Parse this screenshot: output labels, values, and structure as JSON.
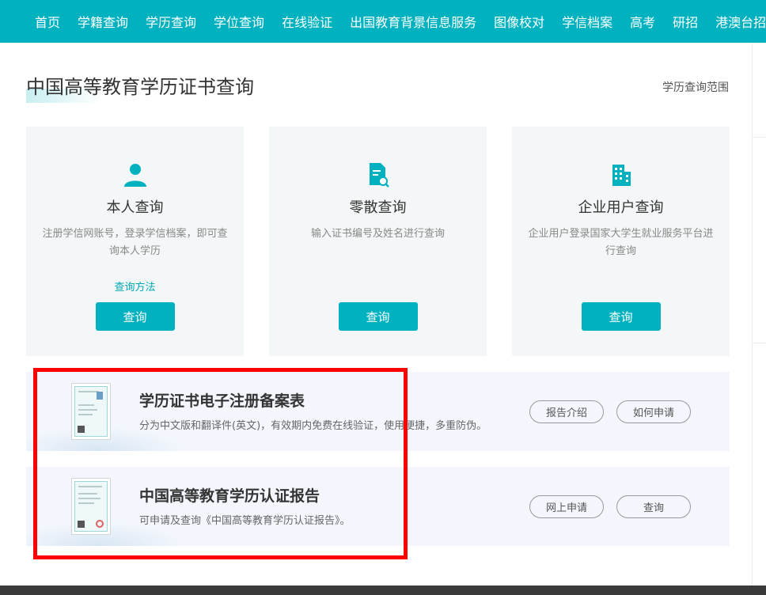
{
  "nav": {
    "items": [
      "首页",
      "学籍查询",
      "学历查询",
      "学位查询",
      "在线验证",
      "出国教育背景信息服务",
      "图像校对",
      "学信档案",
      "高考",
      "研招",
      "港澳台招"
    ]
  },
  "header": {
    "title": "中国高等教育学历证书查询",
    "scope_link": "学历查询范围"
  },
  "cards": [
    {
      "title": "本人查询",
      "desc": "注册学信网账号，登录学信档案，即可查询本人学历",
      "link": "查询方法",
      "button": "查询",
      "icon": "person-icon"
    },
    {
      "title": "零散查询",
      "desc": "输入证书编号及姓名进行查询",
      "button": "查询",
      "icon": "document-search-icon"
    },
    {
      "title": "企业用户查询",
      "desc": "企业用户登录国家大学生就业服务平台进行查询",
      "button": "查询",
      "icon": "building-icon"
    }
  ],
  "banners": [
    {
      "title": "学历证书电子注册备案表",
      "desc": "分为中文版和翻译件(英文)，有效期内免费在线验证，使用便捷，多重防伪。",
      "btn1": "报告介绍",
      "btn2": "如何申请"
    },
    {
      "title": "中国高等教育学历认证报告",
      "desc": "可申请及查询《中国高等教育学历认证报告》。",
      "btn1": "网上申请",
      "btn2": "查询"
    }
  ],
  "colors": {
    "accent": "#00b2c0",
    "highlight": "#ff0000"
  }
}
